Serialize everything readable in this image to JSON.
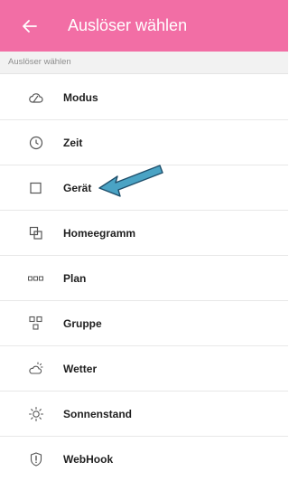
{
  "header": {
    "title": "Auslöser wählen",
    "back_icon": "arrow-left-icon",
    "background_color": "#f26ea5"
  },
  "subheader": {
    "text": "Auslöser wählen"
  },
  "items": [
    {
      "label": "Modus",
      "icon": "cloud-icon"
    },
    {
      "label": "Zeit",
      "icon": "clock-icon"
    },
    {
      "label": "Gerät",
      "icon": "square-icon"
    },
    {
      "label": "Homeegramm",
      "icon": "overlapping-squares-icon"
    },
    {
      "label": "Plan",
      "icon": "three-squares-icon"
    },
    {
      "label": "Gruppe",
      "icon": "group-squares-icon"
    },
    {
      "label": "Wetter",
      "icon": "weather-icon"
    },
    {
      "label": "Sonnenstand",
      "icon": "sun-icon"
    },
    {
      "label": "WebHook",
      "icon": "shield-exclamation-icon"
    }
  ],
  "annotation": {
    "icon": "pointer-arrow-icon",
    "color": "#4aa3c4"
  }
}
